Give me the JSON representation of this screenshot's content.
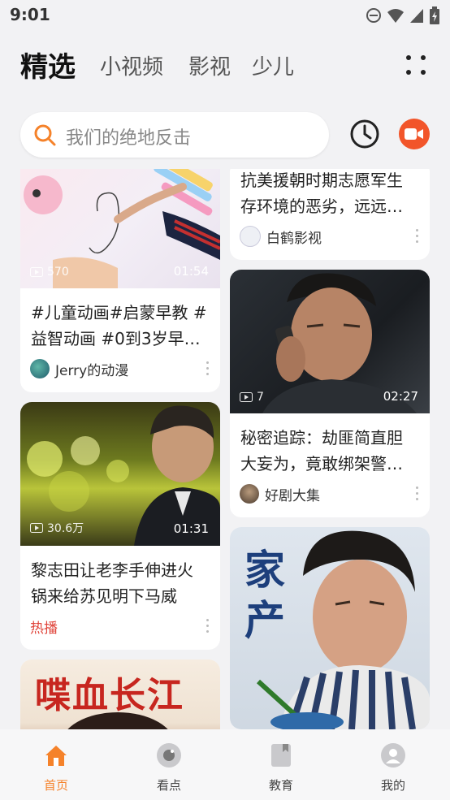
{
  "status_bar": {
    "time": "9:01"
  },
  "top_nav": {
    "tabs": [
      {
        "label": "精选",
        "active": true
      },
      {
        "label": "小视频",
        "active": false
      },
      {
        "label": "影视",
        "active": false
      },
      {
        "label": "少儿",
        "active": false
      }
    ]
  },
  "search": {
    "placeholder": "我们的绝地反击"
  },
  "colors": {
    "accent": "#f5822a",
    "record_button": "#f2552a",
    "hot": "#e0443a"
  },
  "feed": {
    "left": [
      {
        "duration": "01:54",
        "views": "570",
        "title": "#儿童动画#启蒙早教 #益智动画 #0到3岁早…",
        "author": "Jerry的动漫"
      },
      {
        "duration": "01:31",
        "views": "30.6万",
        "title": "黎志田让老李手伸进火锅来给苏见明下马威",
        "tag": "热播"
      },
      {
        "overlay_text": "喋血长江"
      }
    ],
    "right": [
      {
        "title": "抗美援朝时期志愿军生存环境的恶劣，远远…",
        "author": "白鹤影视"
      },
      {
        "duration": "02:27",
        "views": "7",
        "title": "秘密追踪：劫匪简直胆大妄为，竟敢绑架警…",
        "author": "好剧大集"
      },
      {
        "overlay_text": "家产"
      }
    ]
  },
  "bottom_nav": {
    "items": [
      {
        "label": "首页",
        "icon": "home-icon",
        "active": true
      },
      {
        "label": "看点",
        "icon": "kandian-icon",
        "active": false
      },
      {
        "label": "教育",
        "icon": "education-icon",
        "active": false
      },
      {
        "label": "我的",
        "icon": "profile-icon",
        "active": false
      }
    ]
  }
}
